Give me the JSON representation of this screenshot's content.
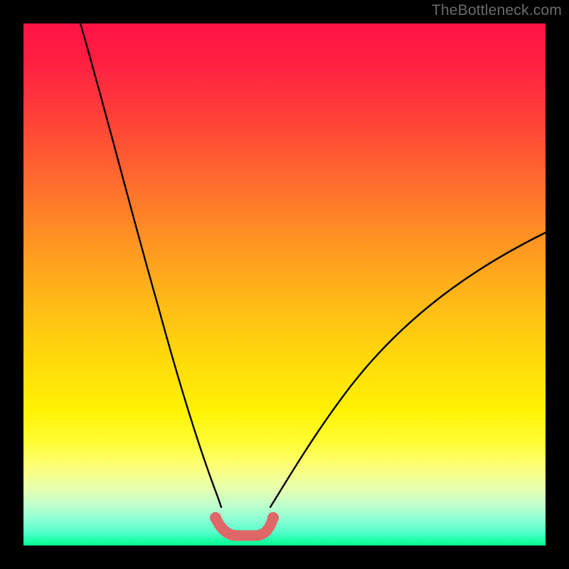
{
  "watermark": "TheBottleneck.com",
  "chart_data": {
    "type": "line",
    "title": "",
    "xlabel": "",
    "ylabel": "",
    "xlim": [
      0,
      100
    ],
    "ylim": [
      0,
      100
    ],
    "series": [
      {
        "name": "black-curve-left",
        "color": "#000000",
        "x": [
          11,
          14,
          17,
          20,
          23,
          26,
          29,
          32,
          35,
          37.8
        ],
        "y": [
          100,
          88,
          76,
          63,
          50,
          38,
          27,
          17,
          9,
          4.3
        ]
      },
      {
        "name": "black-curve-right",
        "color": "#000000",
        "x": [
          47.3,
          51,
          56,
          62,
          68,
          75,
          82,
          90,
          100
        ],
        "y": [
          4.5,
          8,
          14,
          22,
          30,
          38,
          45,
          52,
          60
        ]
      },
      {
        "name": "pink-valley",
        "color": "#e66c6c",
        "x": [
          36.8,
          38,
          40,
          41.5,
          43,
          45,
          46.5,
          47.8
        ],
        "y": [
          5.3,
          3.3,
          2.0,
          1.8,
          1.8,
          2.0,
          3.3,
          5.3
        ]
      }
    ],
    "annotations": []
  }
}
